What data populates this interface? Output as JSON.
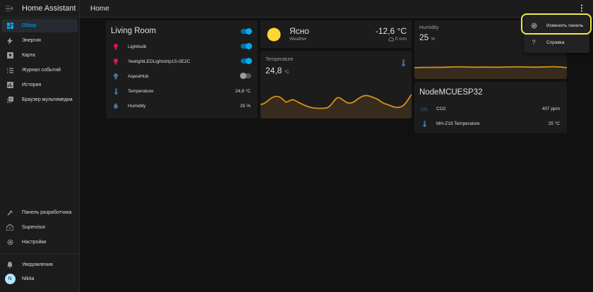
{
  "sidebar": {
    "title": "Home Assistant",
    "items": [
      {
        "label": "Обзор",
        "icon": "dashboard-icon"
      },
      {
        "label": "Энергия",
        "icon": "lightning-icon"
      },
      {
        "label": "Карта",
        "icon": "map-icon"
      },
      {
        "label": "Журнал событий",
        "icon": "list-icon"
      },
      {
        "label": "История",
        "icon": "chart-box-icon"
      },
      {
        "label": "Браузер мультимедиа",
        "icon": "media-icon"
      }
    ],
    "bottom_items": [
      {
        "label": "Панель разработчика",
        "icon": "hammer-icon"
      },
      {
        "label": "Supervisor",
        "icon": "home-assistant-icon"
      },
      {
        "label": "Настройки",
        "icon": "gear-icon"
      }
    ],
    "notifications_label": "Уведомления",
    "user": {
      "initial": "N",
      "name": "Nikita"
    }
  },
  "header": {
    "title": "Home"
  },
  "living_room": {
    "title": "Living Room",
    "rows": [
      {
        "name": "Lightbulb",
        "state": "on"
      },
      {
        "name": "YeelightLEDLightstrip1S-0E2C",
        "state": "on"
      },
      {
        "name": "AqaraHub",
        "state": "off"
      },
      {
        "name": "Temperature",
        "value": "24,8 °C"
      },
      {
        "name": "Humidity",
        "value": "25 %"
      }
    ]
  },
  "weather": {
    "condition": "Ясно",
    "label": "Weather",
    "temperature": "-12,6 °C",
    "precipitation": "0 mm"
  },
  "temperature_card": {
    "label": "Temperature",
    "value": "24,8",
    "unit": "°C"
  },
  "humidity_card": {
    "label": "Humidity",
    "value": "25",
    "unit": "%"
  },
  "node_card": {
    "title": "NodeMCUESP32",
    "rows": [
      {
        "name": "CO2",
        "value": "407 ppm"
      },
      {
        "name": "MH-Z19 Temperature",
        "value": "25 °C"
      }
    ]
  },
  "menu": {
    "items": [
      {
        "label": "Изменить панель",
        "icon": "gear-icon"
      },
      {
        "label": "Справка",
        "icon": "help-icon"
      }
    ]
  },
  "colors": {
    "accent": "#03a9f4",
    "graph": "#d7901a",
    "highlight": "#f1e84a",
    "sun": "#fdd835"
  }
}
